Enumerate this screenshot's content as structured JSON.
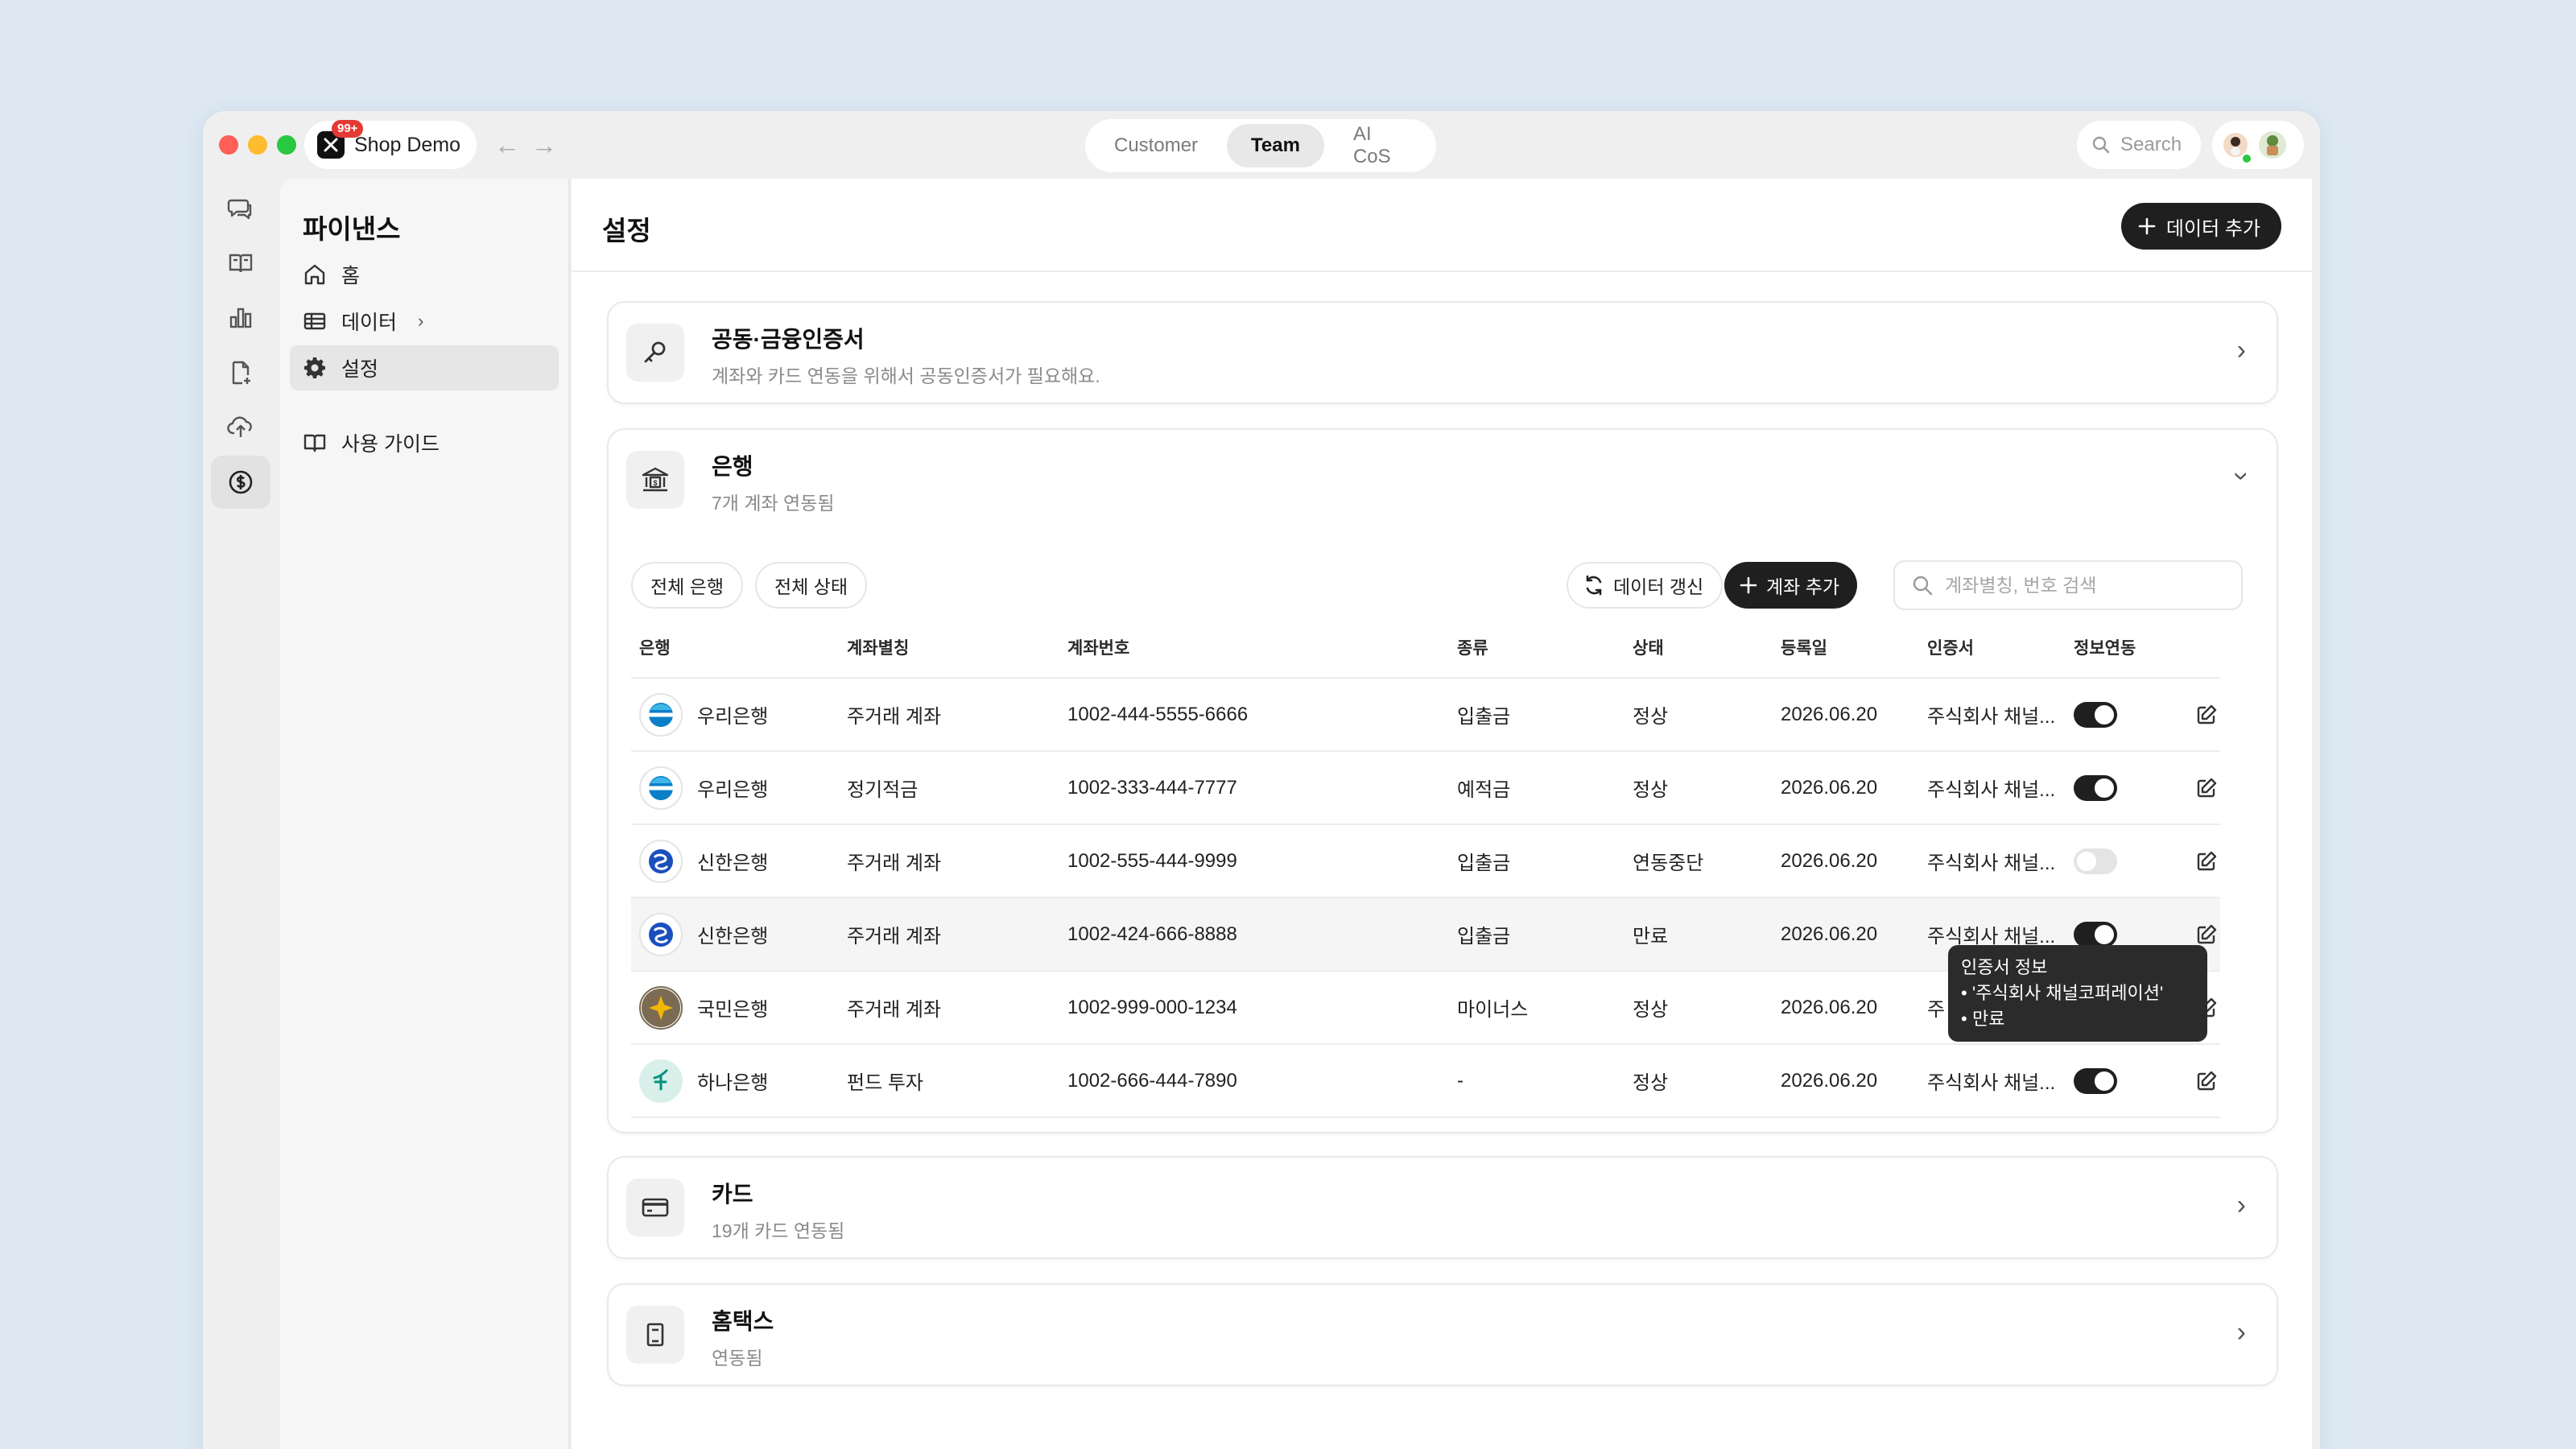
{
  "app": {
    "name": "Shop Demo",
    "badge": "99+"
  },
  "top_tabs": [
    {
      "label": "Customer",
      "active": false
    },
    {
      "label": "Team",
      "active": true
    },
    {
      "label": "AI CoS",
      "active": false
    }
  ],
  "search": {
    "label": "Search"
  },
  "rail": {
    "items": [
      {
        "icon": "chat-bubbles-icon",
        "active": false
      },
      {
        "icon": "book-open-icon",
        "active": false
      },
      {
        "icon": "bar-chart-icon",
        "active": false
      },
      {
        "icon": "document-add-icon",
        "active": false
      },
      {
        "icon": "cloud-upload-icon",
        "active": false
      },
      {
        "icon": "dollar-circle-icon",
        "active": true
      }
    ]
  },
  "sidebar": {
    "title": "파이낸스",
    "items": [
      {
        "label": "홈",
        "icon": "home-icon"
      },
      {
        "label": "데이터",
        "icon": "table-icon"
      },
      {
        "label": "설정",
        "icon": "gear-icon",
        "active": true
      },
      {
        "label": "사용 가이드",
        "icon": "book-icon"
      }
    ]
  },
  "main": {
    "title": "설정",
    "add_data_label": "데이터 추가"
  },
  "cert_card": {
    "title": "공동·금융인증서",
    "subtitle": "계좌와 카드 연동을 위해서 공동인증서가 필요해요."
  },
  "bank_card": {
    "title": "은행",
    "subtitle": "7개 계좌 연동됨",
    "filter_bank": "전체 은행",
    "filter_status": "전체 상태",
    "refresh_label": "데이터 갱신",
    "add_account_label": "계좌 추가",
    "search_placeholder": "계좌별칭, 번호 검색",
    "columns": [
      "은행",
      "계좌별칭",
      "계좌번호",
      "종류",
      "상태",
      "등록일",
      "인증서",
      "정보연동"
    ],
    "rows": [
      {
        "bank": "우리은행",
        "logo": "woori",
        "alias": "주거래 계좌",
        "number": "1002-444-5555-6666",
        "type": "입출금",
        "status": "정상",
        "status_warn": false,
        "date": "2026.06.20",
        "cert": "주식회사 채널...",
        "sync": true
      },
      {
        "bank": "우리은행",
        "logo": "woori",
        "alias": "정기적금",
        "number": "1002-333-444-7777",
        "type": "예적금",
        "status": "정상",
        "status_warn": false,
        "date": "2026.06.20",
        "cert": "주식회사 채널...",
        "sync": true
      },
      {
        "bank": "신한은행",
        "logo": "shinhan",
        "alias": "주거래 계좌",
        "number": "1002-555-444-9999",
        "type": "입출금",
        "status": "연동중단",
        "status_warn": true,
        "date": "2026.06.20",
        "cert": "주식회사 채널...",
        "sync": false
      },
      {
        "bank": "신한은행",
        "logo": "shinhan",
        "alias": "주거래 계좌",
        "number": "1002-424-666-8888",
        "type": "입출금",
        "status": "만료",
        "status_warn": true,
        "date": "2026.06.20",
        "cert": "주식회사 채널...",
        "sync": true
      },
      {
        "bank": "국민은행",
        "logo": "kb",
        "alias": "주거래 계좌",
        "number": "1002-999-000-1234",
        "type": "마이너스",
        "status": "정상",
        "status_warn": false,
        "date": "2026.06.20",
        "cert": "주",
        "sync": null
      },
      {
        "bank": "하나은행",
        "logo": "hana",
        "alias": "펀드 투자",
        "number": "1002-666-444-7890",
        "type": "-",
        "status": "정상",
        "status_warn": false,
        "date": "2026.06.20",
        "cert": "주식회사 채널...",
        "sync": true
      }
    ]
  },
  "tooltip": {
    "title": "인증서 정보",
    "items": [
      "'주식회사 채널코퍼레이션'",
      "만료"
    ]
  },
  "card_card": {
    "title": "카드",
    "subtitle": "19개 카드 연동됨"
  },
  "hometax_card": {
    "title": "홈택스",
    "subtitle": "연동됨"
  },
  "colors": {
    "background": "#dde8f3",
    "dark": "#1f1f1f",
    "warning": "#e8802c",
    "woori": "#0a7fc8",
    "shinhan": "#1a4fbe",
    "kb": "#7a6b52",
    "hana": "#00927f"
  }
}
